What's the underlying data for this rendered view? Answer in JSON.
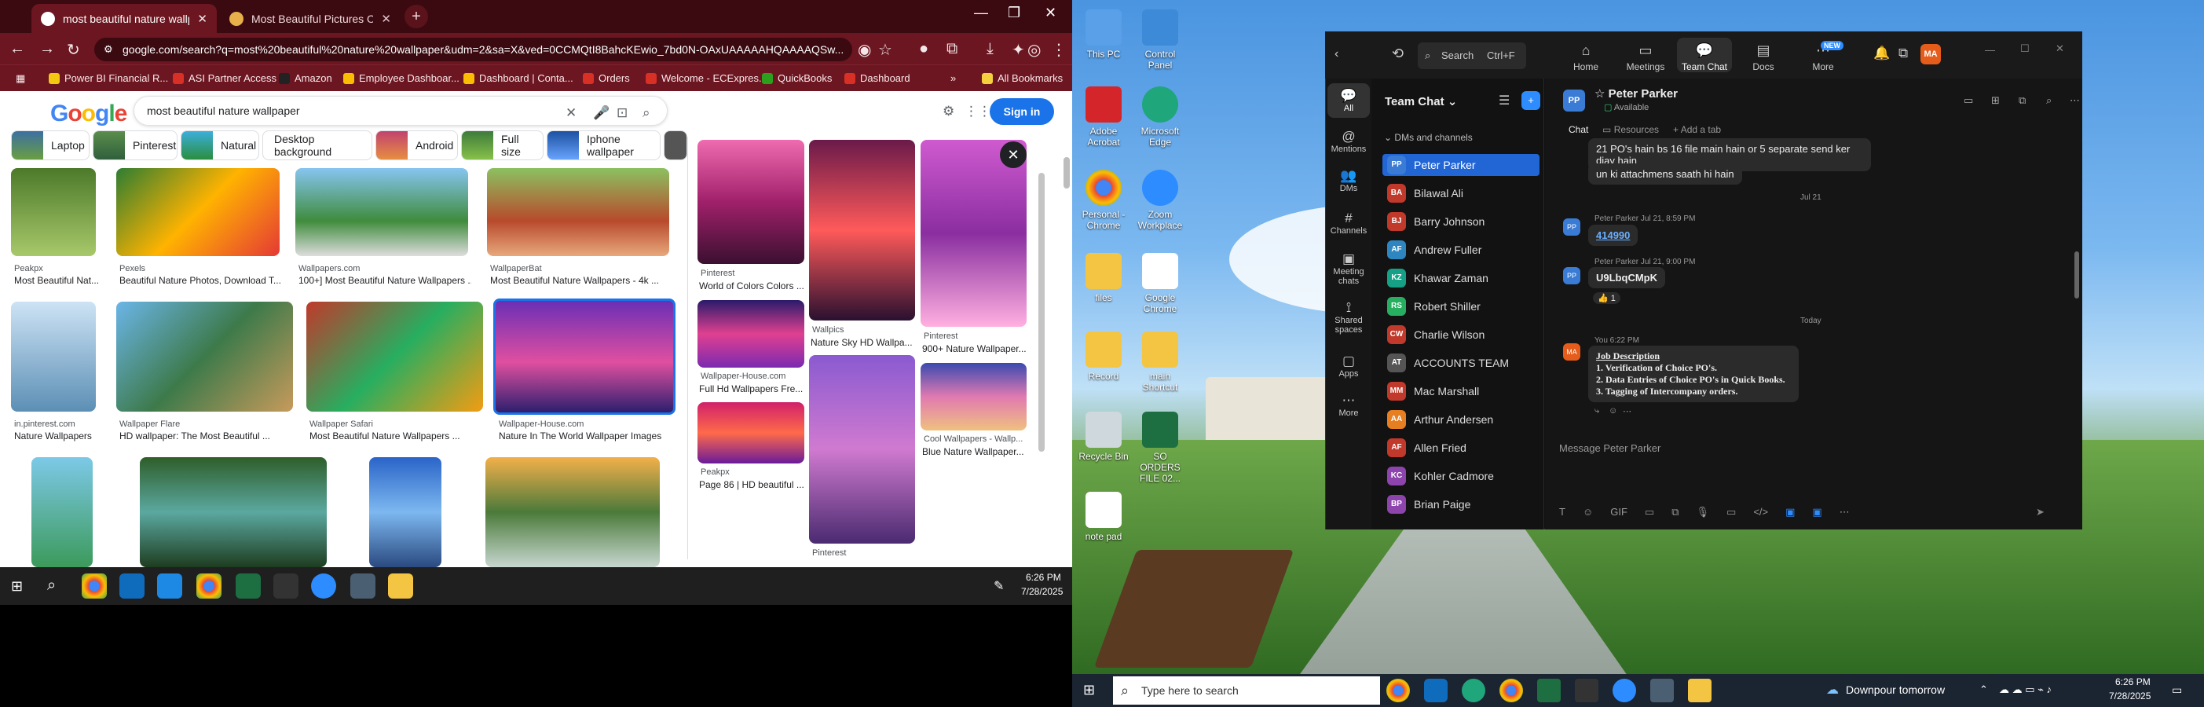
{
  "browser": {
    "tabs": [
      {
        "title": "most beautiful nature wallpaper",
        "active": true
      },
      {
        "title": "Most Beautiful Pictures Of Na...",
        "active": false
      }
    ],
    "url": "google.com/search?q=most%20beautiful%20nature%20wallpaper&udm=2&sa=X&ved=0CCMQtI8BahcKEwio_7bd0N-OAxUAAAAAHQAAAAQSw...",
    "bookmarks": [
      "Power BI Financial R...",
      "ASI Partner Access",
      "Amazon",
      "Employee Dashboar...",
      "Dashboard | Conta...",
      "Orders",
      "Welcome - ECExpres...",
      "QuickBooks",
      "Dashboard",
      "All Bookmarks"
    ]
  },
  "google": {
    "logo": "Google",
    "query": "most beautiful nature wallpaper",
    "sign_in": "Sign in",
    "chips": [
      "Laptop",
      "Pinterest",
      "Natural",
      "Desktop background",
      "Android",
      "Full size",
      "Iphone wallpaper"
    ],
    "results": [
      {
        "src": "Peakpx",
        "title": "Most Beautiful Nat..."
      },
      {
        "src": "Pexels",
        "title": "Beautiful Nature Photos, Download T..."
      },
      {
        "src": "Wallpapers.com",
        "title": "100+] Most Beautiful Nature Wallpapers ..."
      },
      {
        "src": "WallpaperBat",
        "title": "Most Beautiful Nature Wallpapers - 4k ..."
      },
      {
        "src": "in.pinterest.com",
        "title": "Nature Wallpapers"
      },
      {
        "src": "Wallpaper Flare",
        "title": "HD wallpaper: The Most Beautiful ..."
      },
      {
        "src": "Wallpaper Safari",
        "title": "Most Beautiful Nature Wallpapers ..."
      },
      {
        "src": "Wallpaper-House.com",
        "title": "Nature In The World Wallpaper Images"
      }
    ],
    "panel": [
      {
        "src": "Pinterest",
        "title": "World of Colors Colors ..."
      },
      {
        "src": "Wallpics",
        "title": "Nature Sky HD Wallpa..."
      },
      {
        "src": "Pinterest",
        "title": "900+ Nature Wallpaper..."
      },
      {
        "src": "Wallpaper-House.com",
        "title": "Full Hd Wallpapers Fre..."
      },
      {
        "src": "Cool Wallpapers - Wallp...",
        "title": "Blue Nature Wallpaper..."
      },
      {
        "src": "Peakpx",
        "title": "Page 86 | HD beautiful ..."
      },
      {
        "src": "Pinterest",
        "title": ""
      }
    ]
  },
  "taskbar_left": {
    "time": "6:26 PM",
    "date": "7/28/2025"
  },
  "desktop": {
    "icons": [
      "This PC",
      "Control Panel",
      "Adobe Acrobat",
      "Microsoft Edge",
      "Personal - Chrome",
      "Zoom Workplace",
      "files",
      "Google Chrome",
      "Record",
      "main Shortcut",
      "Recycle Bin",
      "SO ORDERS FILE 02...",
      "note pad"
    ]
  },
  "zoom": {
    "search": "Search",
    "search_shortcut": "Ctrl+F",
    "nav": [
      "Home",
      "Meetings",
      "Team Chat",
      "Docs",
      "More"
    ],
    "new_badge": "NEW",
    "avatar": "MA",
    "rail": [
      "All",
      "Mentions",
      "DMs",
      "Channels",
      "Meeting chats",
      "Shared spaces",
      "Apps",
      "More"
    ],
    "list_title": "Team Chat",
    "section": "DMs and channels",
    "contacts": [
      {
        "name": "Peter Parker",
        "initials": "PP",
        "color": "#3a7bd5"
      },
      {
        "name": "Bilawal Ali",
        "initials": "BA",
        "color": "#c0392b"
      },
      {
        "name": "Barry Johnson",
        "initials": "BJ",
        "color": "#c0392b"
      },
      {
        "name": "Andrew Fuller",
        "initials": "AF",
        "color": "#2e86c1"
      },
      {
        "name": "Khawar Zaman",
        "initials": "KZ",
        "color": "#16a085"
      },
      {
        "name": "Robert Shiller",
        "initials": "RS",
        "color": "#27ae60"
      },
      {
        "name": "Charlie Wilson",
        "initials": "CW",
        "color": "#c0392b"
      },
      {
        "name": "ACCOUNTS TEAM",
        "initials": "AT",
        "color": "#555"
      },
      {
        "name": "Mac Marshall",
        "initials": "MM",
        "color": "#c0392b"
      },
      {
        "name": "Arthur Andersen",
        "initials": "AA",
        "color": "#e67e22"
      },
      {
        "name": "Allen Fried",
        "initials": "AF",
        "color": "#c0392b"
      },
      {
        "name": "Kohler Cadmore",
        "initials": "KC",
        "color": "#8e44ad"
      },
      {
        "name": "Brian Paige",
        "initials": "BP",
        "color": "#8e44ad"
      }
    ],
    "chat_name": "Peter Parker",
    "chat_status": "Available",
    "chat_initials": "PP",
    "chat_tabs": [
      "Chat",
      "Resources",
      "Add a tab"
    ],
    "messages": {
      "m1": "21 PO's hain bs 16 file main hain or 5 separate send ker diay hain",
      "m2": "un ki attachmens saath hi hain",
      "date1": "Jul 21",
      "meta1": "Peter Parker Jul 21, 8:59 PM",
      "link": "414990",
      "meta2": "Peter Parker Jul 21, 9:00 PM",
      "code": "U9LbqCMpK",
      "reaction": "👍 1",
      "date2": "Today",
      "meta3": "You 6:22 PM",
      "job_title": "Job Description",
      "job1": "1. Verification of Choice PO's.",
      "job2": "2. Data Entries of Choice PO's in Quick Books.",
      "job3": "3. Tagging of Intercompany orders."
    },
    "compose_placeholder": "Message Peter Parker"
  },
  "taskbar_right": {
    "search": "Type here to search",
    "weather": "Downpour tomorrow",
    "time": "6:26 PM",
    "date": "7/28/2025"
  }
}
